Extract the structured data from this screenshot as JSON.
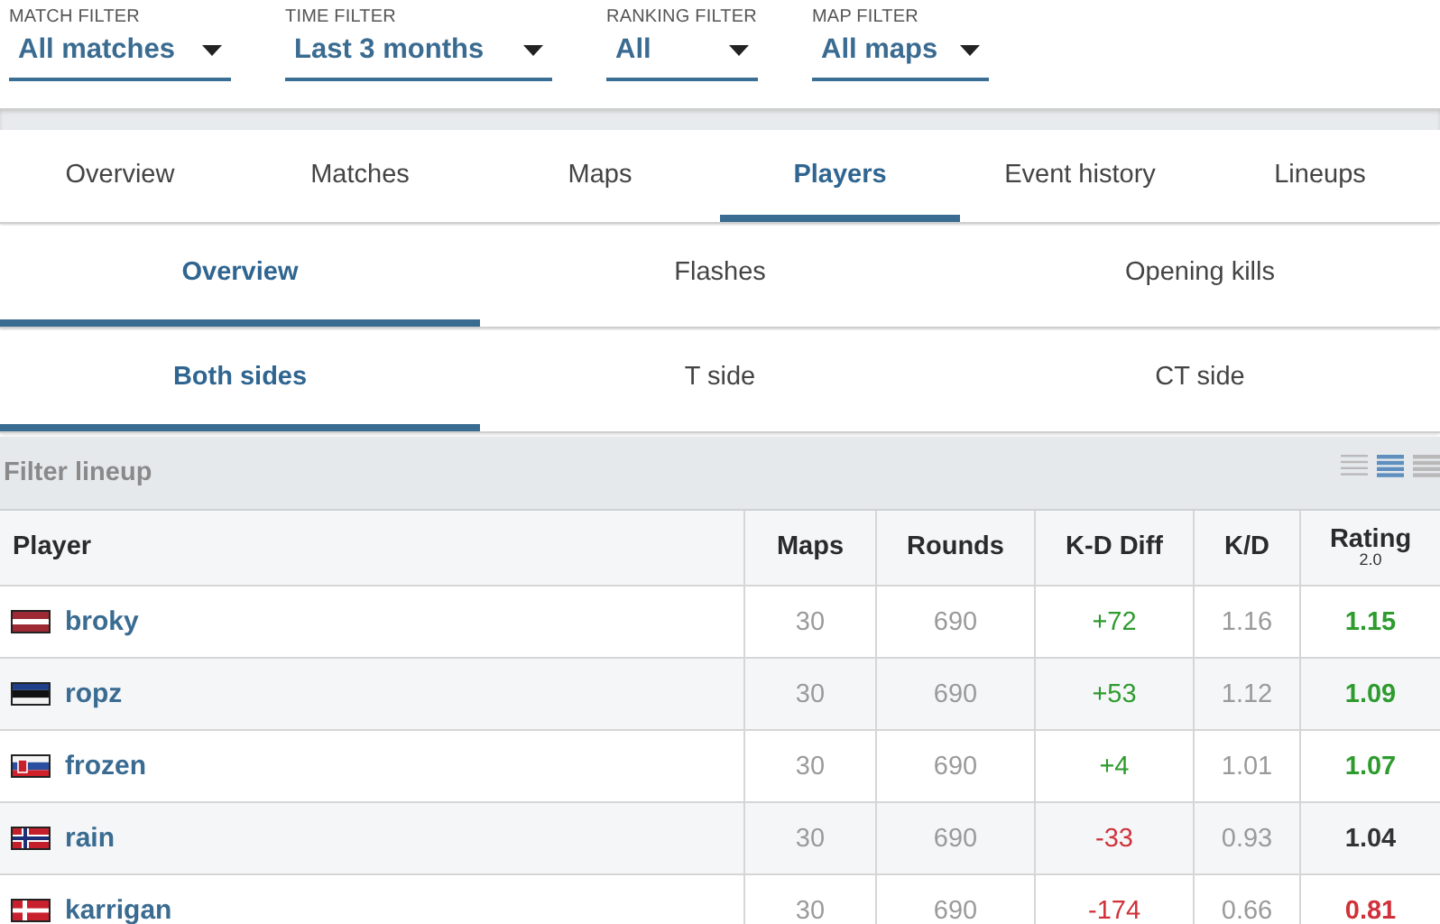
{
  "filters": [
    {
      "label": "MATCH FILTER",
      "value": "All matches"
    },
    {
      "label": "TIME FILTER",
      "value": "Last 3 months"
    },
    {
      "label": "RANKING FILTER",
      "value": "All"
    },
    {
      "label": "MAP FILTER",
      "value": "All maps"
    }
  ],
  "main_tabs": [
    {
      "label": "Overview",
      "selected": false
    },
    {
      "label": "Matches",
      "selected": false
    },
    {
      "label": "Maps",
      "selected": false
    },
    {
      "label": "Players",
      "selected": true
    },
    {
      "label": "Event history",
      "selected": false
    },
    {
      "label": "Lineups",
      "selected": false
    }
  ],
  "stat_tabs": [
    {
      "label": "Overview",
      "selected": true
    },
    {
      "label": "Flashes",
      "selected": false
    },
    {
      "label": "Opening kills",
      "selected": false
    }
  ],
  "side_tabs": [
    {
      "label": "Both sides",
      "selected": true
    },
    {
      "label": "T side",
      "selected": false
    },
    {
      "label": "CT side",
      "selected": false
    }
  ],
  "filter_lineup": {
    "label": "Filter lineup",
    "view_options": [
      {
        "selected": false
      },
      {
        "selected": true
      },
      {
        "selected": false
      }
    ]
  },
  "table": {
    "columns": [
      {
        "label": "Player"
      },
      {
        "label": "Maps"
      },
      {
        "label": "Rounds"
      },
      {
        "label": "K-D Diff"
      },
      {
        "label": "K/D"
      },
      {
        "label": "Rating",
        "sub": "2.0"
      }
    ],
    "rows": [
      {
        "kind": "latvia",
        "player": "broky",
        "maps": "30",
        "rounds": "690",
        "kd_diff": {
          "text": "+72",
          "color": "#2e9b2e"
        },
        "kd": "1.16",
        "rating": {
          "text": "1.15",
          "color": "#2e9b2e"
        }
      },
      {
        "kind": "estonia",
        "player": "ropz",
        "maps": "30",
        "rounds": "690",
        "kd_diff": {
          "text": "+53",
          "color": "#2e9b2e"
        },
        "kd": "1.12",
        "rating": {
          "text": "1.09",
          "color": "#2e9b2e"
        }
      },
      {
        "kind": "slovakia",
        "player": "frozen",
        "maps": "30",
        "rounds": "690",
        "kd_diff": {
          "text": "+4",
          "color": "#2e9b2e"
        },
        "kd": "1.01",
        "rating": {
          "text": "1.07",
          "color": "#2e9b2e"
        }
      },
      {
        "kind": "norway",
        "player": "rain",
        "maps": "30",
        "rounds": "690",
        "kd_diff": {
          "text": "-33",
          "color": "#d0313a"
        },
        "kd": "0.93",
        "rating": {
          "text": "1.04",
          "color": "#333333"
        }
      },
      {
        "kind": "denmark",
        "player": "karrigan",
        "maps": "30",
        "rounds": "690",
        "kd_diff": {
          "text": "-174",
          "color": "#d0313a"
        },
        "kd": "0.66",
        "rating": {
          "text": "0.81",
          "color": "#d0313a"
        }
      }
    ]
  }
}
